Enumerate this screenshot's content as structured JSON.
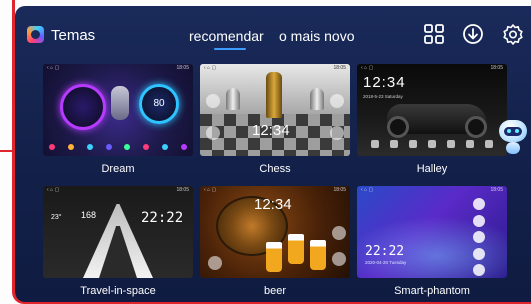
{
  "header": {
    "title": "Temas",
    "tabs": [
      {
        "label": "recomendar",
        "active": true
      },
      {
        "label": "o mais novo",
        "active": false
      }
    ],
    "icons": [
      "grid-icon",
      "download-icon",
      "settings-icon"
    ]
  },
  "themes": [
    {
      "name": "Dream",
      "preview": {
        "speed": "80",
        "status_time": "18:05"
      }
    },
    {
      "name": "Chess",
      "preview": {
        "time": "12:34",
        "status_time": "18:05"
      }
    },
    {
      "name": "Halley",
      "preview": {
        "time": "12:34",
        "date": "2018-5-23 Saturday",
        "status_time": "18:05"
      }
    },
    {
      "name": "Travel-in-space",
      "preview": {
        "temp": "23°",
        "speed": "168",
        "time": "22:22",
        "status_time": "18:05"
      }
    },
    {
      "name": "beer",
      "preview": {
        "time": "12:34",
        "status_time": "18:05"
      }
    },
    {
      "name": "Smart-phantom",
      "preview": {
        "time": "22:22",
        "date": "2020-04-20 Tuesday",
        "status_time": "18:05"
      }
    }
  ],
  "colors": {
    "background": "#14224d",
    "accent": "#3c9dff",
    "frame": "#e0262c"
  }
}
